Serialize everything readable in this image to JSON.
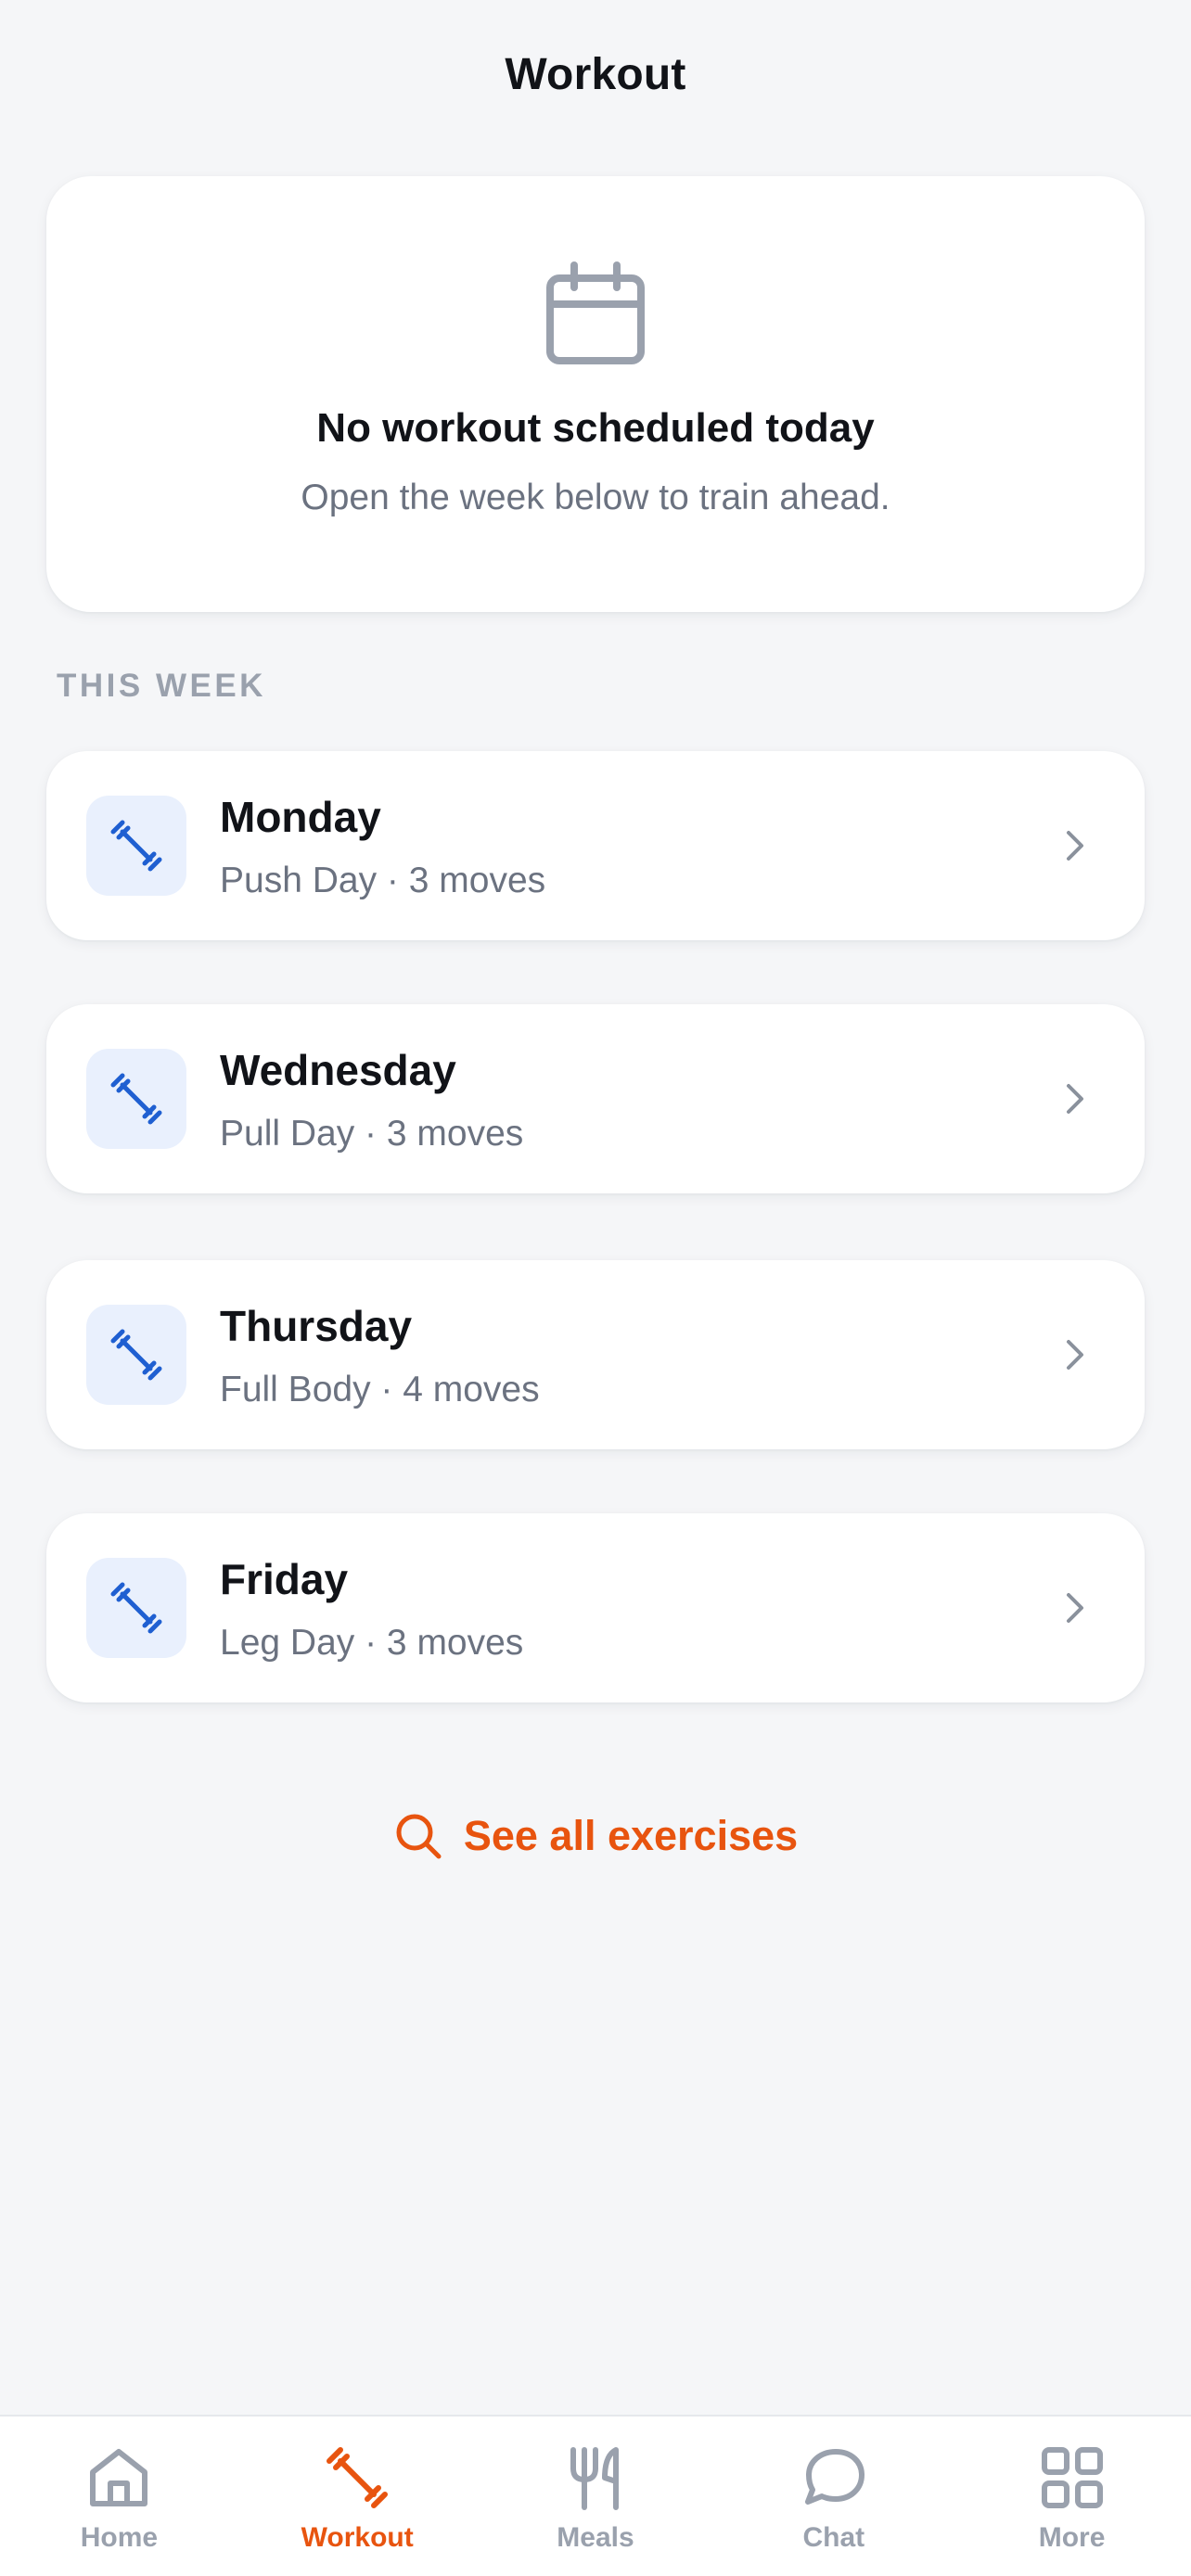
{
  "header": {
    "title": "Workout"
  },
  "empty_state": {
    "icon": "calendar-icon",
    "title": "No workout scheduled today",
    "subtitle": "Open the week below to train ahead."
  },
  "week": {
    "section_label": "THIS WEEK",
    "days": [
      {
        "name": "Monday",
        "detail": "Push Day · 3 moves",
        "icon": "dumbbell-icon"
      },
      {
        "name": "Wednesday",
        "detail": "Pull Day · 3 moves",
        "icon": "dumbbell-icon"
      },
      {
        "name": "Thursday",
        "detail": "Full Body · 4 moves",
        "icon": "dumbbell-icon"
      },
      {
        "name": "Friday",
        "detail": "Leg Day · 3 moves",
        "icon": "dumbbell-icon"
      }
    ]
  },
  "see_all": {
    "label": "See all exercises",
    "icon": "search-icon"
  },
  "tabbar": {
    "active": "Workout",
    "tabs": [
      {
        "label": "Home",
        "icon": "home-icon"
      },
      {
        "label": "Workout",
        "icon": "dumbbell-icon"
      },
      {
        "label": "Meals",
        "icon": "fork-knife-icon"
      },
      {
        "label": "Chat",
        "icon": "chat-bubble-icon"
      },
      {
        "label": "More",
        "icon": "grid-icon"
      }
    ]
  },
  "colors": {
    "accent": "#e8540f",
    "icon_blue": "#1f5fd1",
    "icon_bg": "#e9f0fd",
    "muted": "#9aa1ad",
    "background": "#f5f6f8"
  }
}
